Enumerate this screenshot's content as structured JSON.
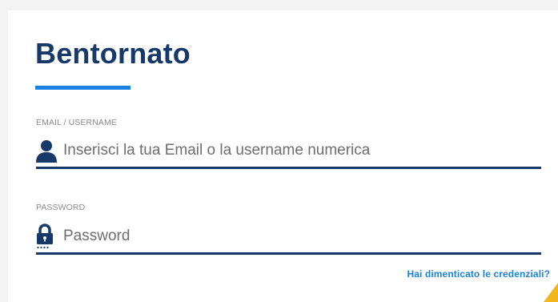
{
  "login": {
    "title": "Bentornato",
    "email_label": "EMAIL / USERNAME",
    "email_placeholder": "Inserisci la tua Email o la username numerica",
    "email_value": "",
    "email_icon": "user-icon",
    "password_label": "PASSWORD",
    "password_placeholder": "Password",
    "password_value": "",
    "password_icon": "lock-icon",
    "forgot_link": "Hai dimenticato le credenziali?"
  },
  "colors": {
    "title": "#17396a",
    "accent": "#1a82e0",
    "underline": "#17396a",
    "corner": "#f2b51c"
  }
}
